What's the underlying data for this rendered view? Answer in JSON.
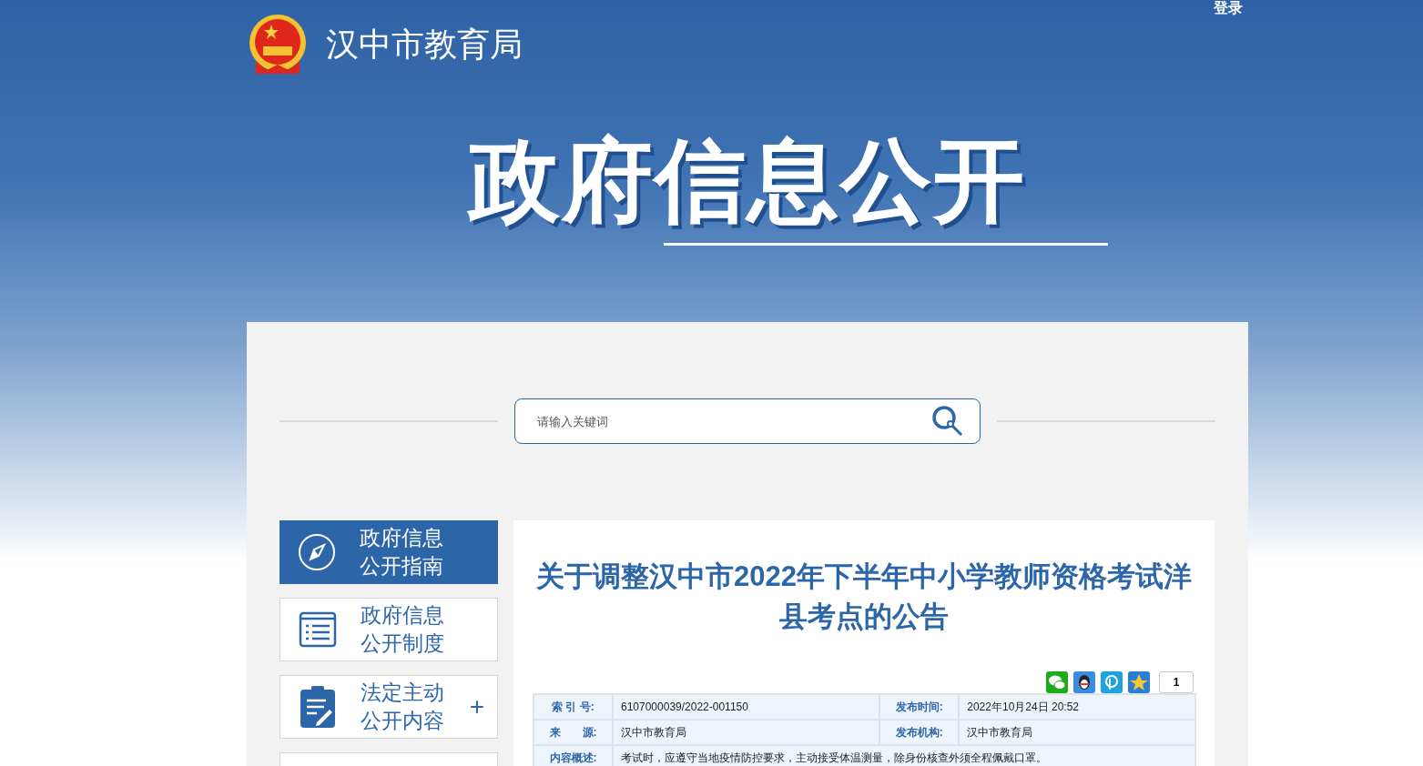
{
  "header": {
    "site_name": "汉中市教育局",
    "login": "登录",
    "banner_title": "政府信息公开"
  },
  "search": {
    "placeholder": "请输入关键词"
  },
  "sidebar": {
    "items": [
      {
        "label": "政府信息公开指南",
        "selected": true
      },
      {
        "label": "政府信息公开制度",
        "selected": false
      },
      {
        "label": "法定主动公开内容",
        "selected": false,
        "expand_symbol": "+"
      },
      {
        "selected": false
      }
    ]
  },
  "article": {
    "title": "关于调整汉中市2022年下半年中小学教师资格考试洋县考点的公告",
    "share": {
      "count": "1"
    },
    "meta": [
      {
        "cells": [
          {
            "label": "索 引 号:",
            "value": "6107000039/2022-001150"
          },
          {
            "label": "发布时间:",
            "value": "2022年10月24日 20:52"
          }
        ]
      },
      {
        "cells": [
          {
            "label": "来　　源:",
            "value": "汉中市教育局"
          },
          {
            "label": "发布机构:",
            "value": "汉中市教育局"
          }
        ]
      },
      {
        "cells": [
          {
            "label": "内容概述:",
            "value": "考试时，应遵守当地疫情防控要求，主动接受体温测量，除身份核查外须全程佩戴口罩。"
          }
        ]
      }
    ]
  }
}
